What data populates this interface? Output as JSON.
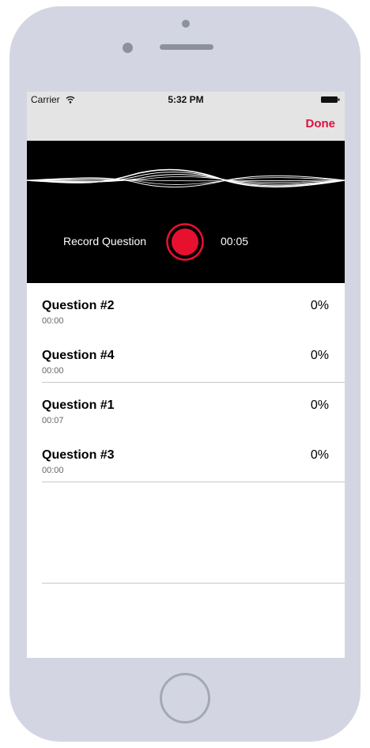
{
  "status_bar": {
    "carrier": "Carrier",
    "time": "5:32 PM"
  },
  "nav": {
    "done_label": "Done"
  },
  "recorder": {
    "label": "Record Question",
    "timer": "00:05"
  },
  "questions": [
    {
      "title": "Question #2",
      "duration": "00:00",
      "percent": "0%"
    },
    {
      "title": "Question #4",
      "duration": "00:00",
      "percent": "0%"
    },
    {
      "title": "Question #1",
      "duration": "00:07",
      "percent": "0%"
    },
    {
      "title": "Question #3",
      "duration": "00:00",
      "percent": "0%"
    }
  ],
  "colors": {
    "accent": "#e0103f",
    "record_red": "#e8102f",
    "device_body": "#d3d6e2"
  }
}
